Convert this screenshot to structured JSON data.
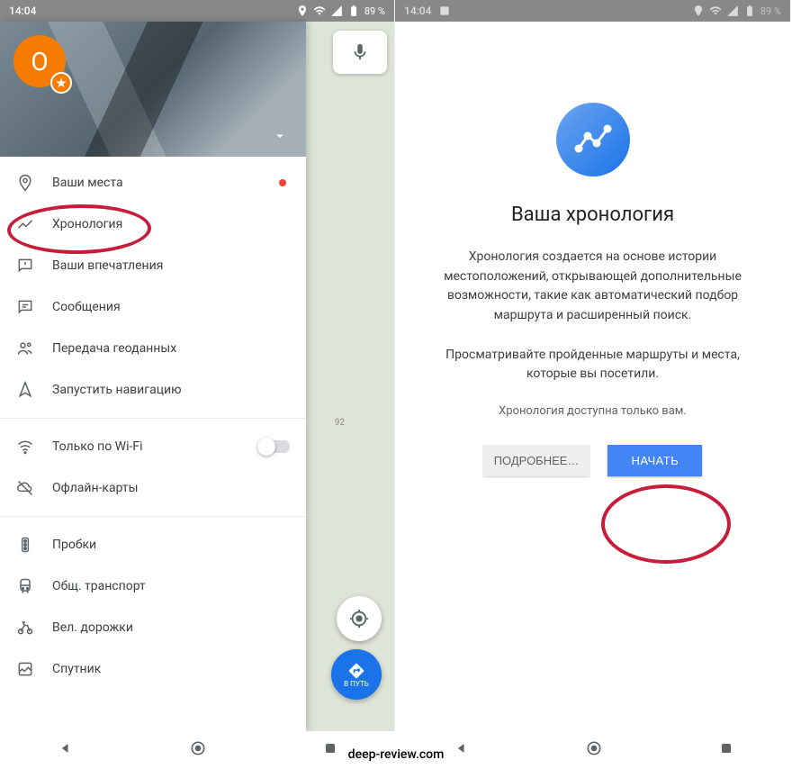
{
  "status": {
    "time": "14:04",
    "battery": "89 %"
  },
  "avatar_initial": "O",
  "menu": {
    "your_places": "Ваши места",
    "timeline": "Хронология",
    "contributions": "Ваши впечатления",
    "messages": "Сообщения",
    "location_sharing": "Передача геоданных",
    "start_nav": "Запустить навигацию",
    "wifi_only": "Только по Wi-Fi",
    "offline_maps": "Офлайн-карты",
    "traffic": "Пробки",
    "transit": "Общ. транспорт",
    "bike": "Вел. дорожки",
    "satellite": "Спутник"
  },
  "directions_label": "В ПУТЬ",
  "map_route_label": "92",
  "onboard": {
    "title": "Ваша хронология",
    "body1": "Хронология создается на основе истории местоположений, открывающей дополнительные возможности, такие как автоматический подбор маршрута и расширенный поиск.",
    "body2": "Просматривайте пройденные маршруты и места, которые вы посетили.",
    "privacy": "Хронология доступна только вам.",
    "more": "ПОДРОБНЕЕ…",
    "start": "НАЧАТЬ"
  },
  "watermark": "deep-review.com"
}
